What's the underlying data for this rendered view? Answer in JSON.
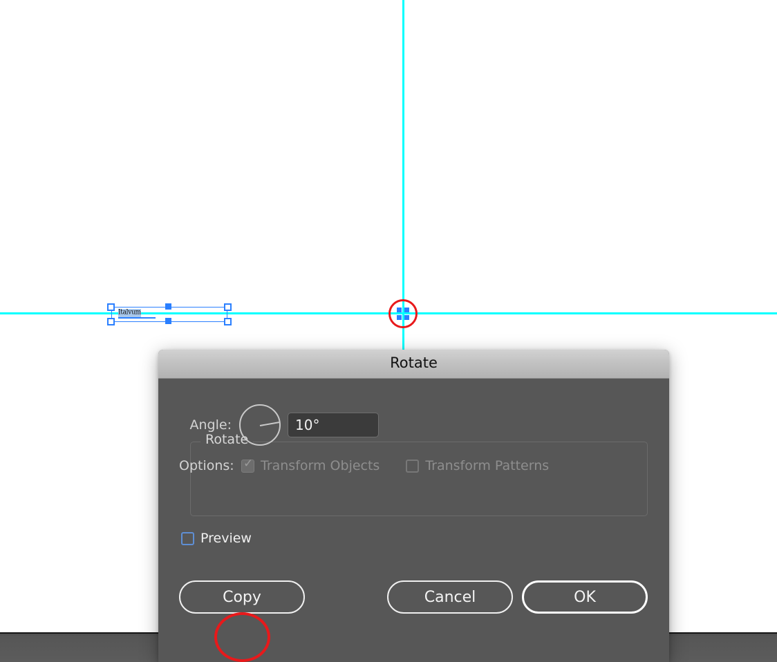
{
  "canvas": {
    "text_object": {
      "content": "Italvum",
      "selected": true
    },
    "guides": {
      "horizontal_color": "#00ffff",
      "vertical_color": "#00ffff"
    },
    "origin_marker_name": "rotation-origin"
  },
  "dialog": {
    "title": "Rotate",
    "group": {
      "legend": "Rotate",
      "angle": {
        "label": "Angle:",
        "value": "10°",
        "dial_degrees": 10
      },
      "options": {
        "label": "Options:",
        "items": [
          {
            "label": "Transform Objects",
            "checked": true,
            "enabled": false
          },
          {
            "label": "Transform Patterns",
            "checked": false,
            "enabled": false
          }
        ]
      }
    },
    "preview": {
      "label": "Preview",
      "checked": false
    },
    "buttons": {
      "copy": "Copy",
      "cancel": "Cancel",
      "ok": "OK"
    }
  },
  "annotations": {
    "origin_highlight_color": "#e8191b",
    "copy_highlight_color": "#e8191b"
  }
}
